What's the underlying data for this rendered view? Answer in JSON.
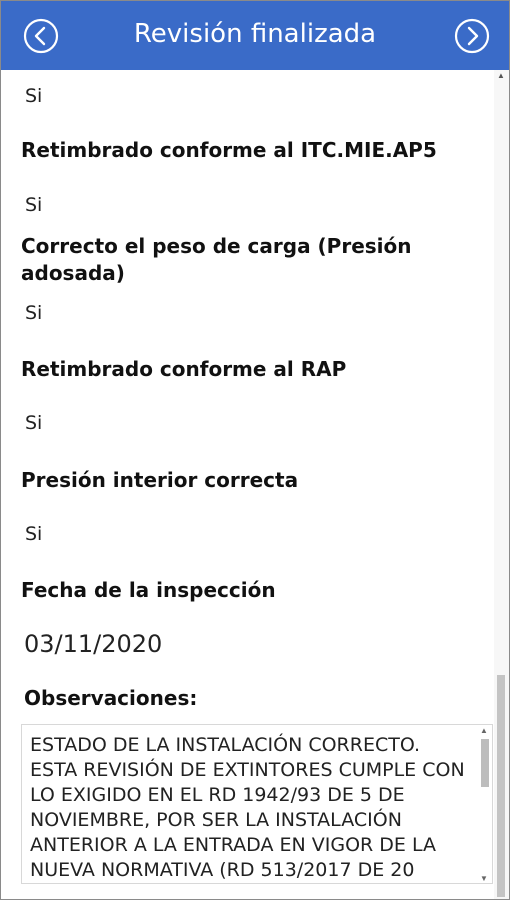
{
  "header": {
    "title": "Revisión finalizada",
    "back_icon": "chevron-left-circle-icon",
    "next_icon": "chevron-right-circle-icon",
    "color": "#3a6bc8"
  },
  "fields": [
    {
      "label": "",
      "value": "Si"
    },
    {
      "label": "Retimbrado conforme al ITC.MIE.AP5",
      "value": "Si"
    },
    {
      "label": "Correcto el peso de carga (Presión adosada)",
      "value": "Si"
    },
    {
      "label": "Retimbrado conforme al RAP",
      "value": "Si"
    },
    {
      "label": "Presión interior correcta",
      "value": "Si"
    },
    {
      "label": "Fecha de la inspección",
      "value": "03/11/2020"
    }
  ],
  "observaciones": {
    "label": "Observaciones:",
    "text": "ESTADO DE LA INSTALACIÓN CORRECTO. ESTA REVISIÓN DE EXTINTORES CUMPLE CON LO EXIGIDO EN EL RD 1942/93 DE 5 DE NOVIEMBRE, POR SER LA INSTALACIÓN ANTERIOR A LA ENTRADA EN VIGOR DE LA NUEVA NORMATIVA (RD 513/2017 DE 20"
  }
}
